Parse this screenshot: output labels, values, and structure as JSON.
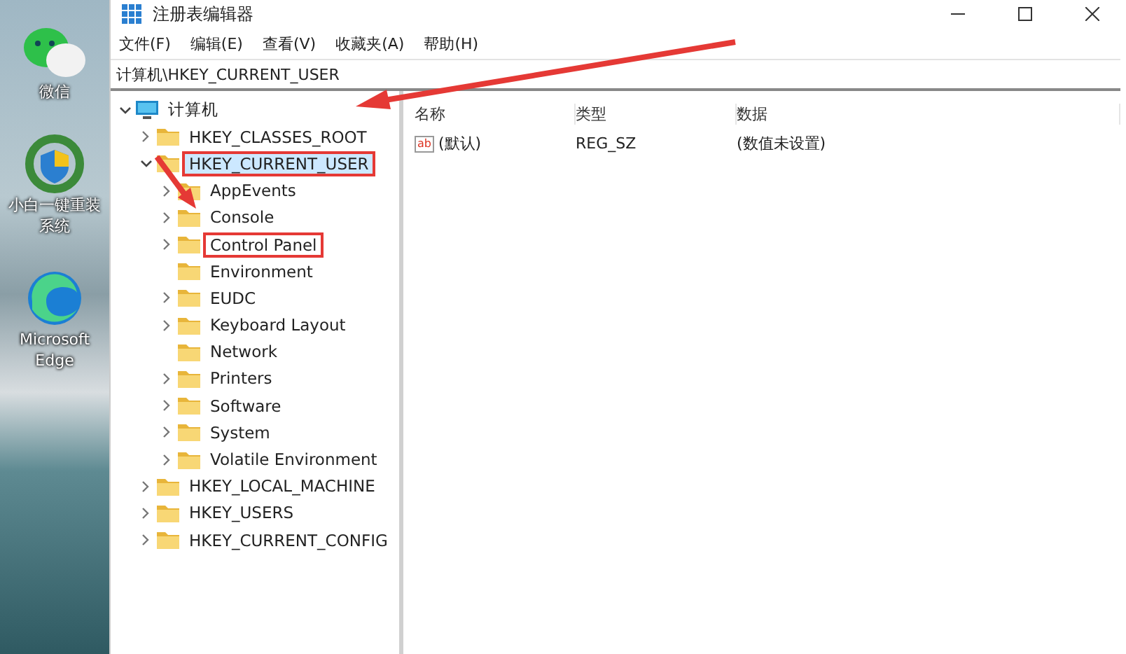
{
  "desktop": {
    "icons": [
      {
        "kind": "chat",
        "label": "微信"
      },
      {
        "kind": "installer",
        "label": "小白一键重装系统"
      },
      {
        "kind": "browser",
        "label": "Microsoft Edge"
      }
    ]
  },
  "window": {
    "title": "注册表编辑器"
  },
  "menu": [
    "文件(F)",
    "编辑(E)",
    "查看(V)",
    "收藏夹(A)",
    "帮助(H)"
  ],
  "address": "计算机\\HKEY_CURRENT_USER",
  "tree": [
    {
      "label": "计算机",
      "kind": "computer",
      "expanded": true,
      "selected": false,
      "annotated": false,
      "children": [
        {
          "label": "HKEY_CLASSES_ROOT",
          "kind": "folder",
          "expandable": true,
          "expanded": false,
          "selected": false,
          "annotated": false
        },
        {
          "label": "HKEY_CURRENT_USER",
          "kind": "folder",
          "expandable": true,
          "expanded": true,
          "selected": true,
          "annotated": true,
          "children": [
            {
              "label": "AppEvents",
              "kind": "folder",
              "expandable": true,
              "expanded": false,
              "selected": false,
              "annotated": false
            },
            {
              "label": "Console",
              "kind": "folder",
              "expandable": true,
              "expanded": false,
              "selected": false,
              "annotated": false
            },
            {
              "label": "Control Panel",
              "kind": "folder",
              "expandable": true,
              "expanded": false,
              "selected": false,
              "annotated": true
            },
            {
              "label": "Environment",
              "kind": "folder",
              "expandable": false,
              "expanded": false,
              "selected": false,
              "annotated": false
            },
            {
              "label": "EUDC",
              "kind": "folder",
              "expandable": true,
              "expanded": false,
              "selected": false,
              "annotated": false
            },
            {
              "label": "Keyboard Layout",
              "kind": "folder",
              "expandable": true,
              "expanded": false,
              "selected": false,
              "annotated": false
            },
            {
              "label": "Network",
              "kind": "folder",
              "expandable": false,
              "expanded": false,
              "selected": false,
              "annotated": false
            },
            {
              "label": "Printers",
              "kind": "folder",
              "expandable": true,
              "expanded": false,
              "selected": false,
              "annotated": false
            },
            {
              "label": "Software",
              "kind": "folder",
              "expandable": true,
              "expanded": false,
              "selected": false,
              "annotated": false
            },
            {
              "label": "System",
              "kind": "folder",
              "expandable": true,
              "expanded": false,
              "selected": false,
              "annotated": false
            },
            {
              "label": "Volatile Environment",
              "kind": "folder",
              "expandable": true,
              "expanded": false,
              "selected": false,
              "annotated": false
            }
          ]
        },
        {
          "label": "HKEY_LOCAL_MACHINE",
          "kind": "folder",
          "expandable": true,
          "expanded": false,
          "selected": false,
          "annotated": false
        },
        {
          "label": "HKEY_USERS",
          "kind": "folder",
          "expandable": true,
          "expanded": false,
          "selected": false,
          "annotated": false
        },
        {
          "label": "HKEY_CURRENT_CONFIG",
          "kind": "folder",
          "expandable": true,
          "expanded": false,
          "selected": false,
          "annotated": false
        }
      ]
    }
  ],
  "values": {
    "columns": [
      "名称",
      "类型",
      "数据"
    ],
    "rows": [
      {
        "icon_text": "ab",
        "name": "(默认)",
        "type": "REG_SZ",
        "data": "(数值未设置)"
      }
    ]
  }
}
